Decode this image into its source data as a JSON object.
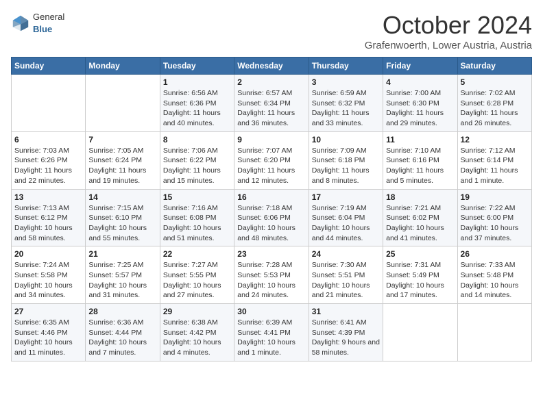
{
  "header": {
    "logo_general": "General",
    "logo_blue": "Blue",
    "title": "October 2024",
    "location": "Grafenwoerth, Lower Austria, Austria"
  },
  "weekdays": [
    "Sunday",
    "Monday",
    "Tuesday",
    "Wednesday",
    "Thursday",
    "Friday",
    "Saturday"
  ],
  "weeks": [
    [
      {
        "day": "",
        "sunrise": "",
        "sunset": "",
        "daylight": ""
      },
      {
        "day": "",
        "sunrise": "",
        "sunset": "",
        "daylight": ""
      },
      {
        "day": "1",
        "sunrise": "Sunrise: 6:56 AM",
        "sunset": "Sunset: 6:36 PM",
        "daylight": "Daylight: 11 hours and 40 minutes."
      },
      {
        "day": "2",
        "sunrise": "Sunrise: 6:57 AM",
        "sunset": "Sunset: 6:34 PM",
        "daylight": "Daylight: 11 hours and 36 minutes."
      },
      {
        "day": "3",
        "sunrise": "Sunrise: 6:59 AM",
        "sunset": "Sunset: 6:32 PM",
        "daylight": "Daylight: 11 hours and 33 minutes."
      },
      {
        "day": "4",
        "sunrise": "Sunrise: 7:00 AM",
        "sunset": "Sunset: 6:30 PM",
        "daylight": "Daylight: 11 hours and 29 minutes."
      },
      {
        "day": "5",
        "sunrise": "Sunrise: 7:02 AM",
        "sunset": "Sunset: 6:28 PM",
        "daylight": "Daylight: 11 hours and 26 minutes."
      }
    ],
    [
      {
        "day": "6",
        "sunrise": "Sunrise: 7:03 AM",
        "sunset": "Sunset: 6:26 PM",
        "daylight": "Daylight: 11 hours and 22 minutes."
      },
      {
        "day": "7",
        "sunrise": "Sunrise: 7:05 AM",
        "sunset": "Sunset: 6:24 PM",
        "daylight": "Daylight: 11 hours and 19 minutes."
      },
      {
        "day": "8",
        "sunrise": "Sunrise: 7:06 AM",
        "sunset": "Sunset: 6:22 PM",
        "daylight": "Daylight: 11 hours and 15 minutes."
      },
      {
        "day": "9",
        "sunrise": "Sunrise: 7:07 AM",
        "sunset": "Sunset: 6:20 PM",
        "daylight": "Daylight: 11 hours and 12 minutes."
      },
      {
        "day": "10",
        "sunrise": "Sunrise: 7:09 AM",
        "sunset": "Sunset: 6:18 PM",
        "daylight": "Daylight: 11 hours and 8 minutes."
      },
      {
        "day": "11",
        "sunrise": "Sunrise: 7:10 AM",
        "sunset": "Sunset: 6:16 PM",
        "daylight": "Daylight: 11 hours and 5 minutes."
      },
      {
        "day": "12",
        "sunrise": "Sunrise: 7:12 AM",
        "sunset": "Sunset: 6:14 PM",
        "daylight": "Daylight: 11 hours and 1 minute."
      }
    ],
    [
      {
        "day": "13",
        "sunrise": "Sunrise: 7:13 AM",
        "sunset": "Sunset: 6:12 PM",
        "daylight": "Daylight: 10 hours and 58 minutes."
      },
      {
        "day": "14",
        "sunrise": "Sunrise: 7:15 AM",
        "sunset": "Sunset: 6:10 PM",
        "daylight": "Daylight: 10 hours and 55 minutes."
      },
      {
        "day": "15",
        "sunrise": "Sunrise: 7:16 AM",
        "sunset": "Sunset: 6:08 PM",
        "daylight": "Daylight: 10 hours and 51 minutes."
      },
      {
        "day": "16",
        "sunrise": "Sunrise: 7:18 AM",
        "sunset": "Sunset: 6:06 PM",
        "daylight": "Daylight: 10 hours and 48 minutes."
      },
      {
        "day": "17",
        "sunrise": "Sunrise: 7:19 AM",
        "sunset": "Sunset: 6:04 PM",
        "daylight": "Daylight: 10 hours and 44 minutes."
      },
      {
        "day": "18",
        "sunrise": "Sunrise: 7:21 AM",
        "sunset": "Sunset: 6:02 PM",
        "daylight": "Daylight: 10 hours and 41 minutes."
      },
      {
        "day": "19",
        "sunrise": "Sunrise: 7:22 AM",
        "sunset": "Sunset: 6:00 PM",
        "daylight": "Daylight: 10 hours and 37 minutes."
      }
    ],
    [
      {
        "day": "20",
        "sunrise": "Sunrise: 7:24 AM",
        "sunset": "Sunset: 5:58 PM",
        "daylight": "Daylight: 10 hours and 34 minutes."
      },
      {
        "day": "21",
        "sunrise": "Sunrise: 7:25 AM",
        "sunset": "Sunset: 5:57 PM",
        "daylight": "Daylight: 10 hours and 31 minutes."
      },
      {
        "day": "22",
        "sunrise": "Sunrise: 7:27 AM",
        "sunset": "Sunset: 5:55 PM",
        "daylight": "Daylight: 10 hours and 27 minutes."
      },
      {
        "day": "23",
        "sunrise": "Sunrise: 7:28 AM",
        "sunset": "Sunset: 5:53 PM",
        "daylight": "Daylight: 10 hours and 24 minutes."
      },
      {
        "day": "24",
        "sunrise": "Sunrise: 7:30 AM",
        "sunset": "Sunset: 5:51 PM",
        "daylight": "Daylight: 10 hours and 21 minutes."
      },
      {
        "day": "25",
        "sunrise": "Sunrise: 7:31 AM",
        "sunset": "Sunset: 5:49 PM",
        "daylight": "Daylight: 10 hours and 17 minutes."
      },
      {
        "day": "26",
        "sunrise": "Sunrise: 7:33 AM",
        "sunset": "Sunset: 5:48 PM",
        "daylight": "Daylight: 10 hours and 14 minutes."
      }
    ],
    [
      {
        "day": "27",
        "sunrise": "Sunrise: 6:35 AM",
        "sunset": "Sunset: 4:46 PM",
        "daylight": "Daylight: 10 hours and 11 minutes."
      },
      {
        "day": "28",
        "sunrise": "Sunrise: 6:36 AM",
        "sunset": "Sunset: 4:44 PM",
        "daylight": "Daylight: 10 hours and 7 minutes."
      },
      {
        "day": "29",
        "sunrise": "Sunrise: 6:38 AM",
        "sunset": "Sunset: 4:42 PM",
        "daylight": "Daylight: 10 hours and 4 minutes."
      },
      {
        "day": "30",
        "sunrise": "Sunrise: 6:39 AM",
        "sunset": "Sunset: 4:41 PM",
        "daylight": "Daylight: 10 hours and 1 minute."
      },
      {
        "day": "31",
        "sunrise": "Sunrise: 6:41 AM",
        "sunset": "Sunset: 4:39 PM",
        "daylight": "Daylight: 9 hours and 58 minutes."
      },
      {
        "day": "",
        "sunrise": "",
        "sunset": "",
        "daylight": ""
      },
      {
        "day": "",
        "sunrise": "",
        "sunset": "",
        "daylight": ""
      }
    ]
  ]
}
